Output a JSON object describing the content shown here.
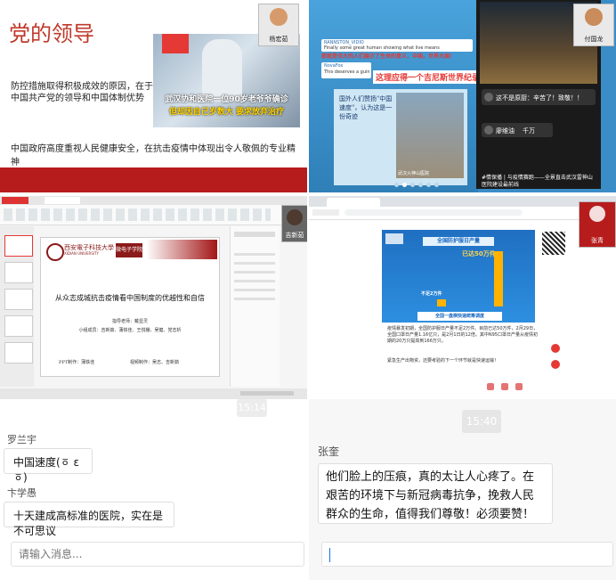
{
  "q1": {
    "title": "党的领导",
    "line1": "防控措施取得积极成效的原因，在于",
    "line2": "中国共产党的领导和中国体制优势",
    "line3": "中国政府高度重视人民健康安全，在抗击疫情中体现出令人敬佩的专业精神",
    "caption1": "武汉协和医院一位90岁老爷爷确诊",
    "caption2": "但却因自己岁数大 要求放弃治疗",
    "participant": "杨宏茹"
  },
  "q2": {
    "banner": "这理应得一个吉尼斯世界纪录",
    "comment_name": "RANNSTON_VIDIO",
    "comment_text": "Finally some great human showing what live means",
    "comment_cn": "那就是伟大的人们展示了生命的意义，中国，世界大国！",
    "reply_name": "NovaFox",
    "reply_text": "This deserves a guinness record",
    "book_text": "国外人们赞扬\"中国速度\"，认为这是一份奇迹",
    "inset_caption": "武汉火神山医院",
    "chat_msg1": "这不是原厨：辛苦了！致敬！！",
    "chat_msg2": "千万",
    "chat_name2": "廖维油",
    "footer": "#情保播 | 与疫情赛跑——全景直击武汉雷神山医院建设最前线",
    "participant": "付国龙"
  },
  "q3": {
    "school_cn": "西安電子科技大學",
    "school_en": "XIDIAN UNIVERSITY",
    "logo_text": "微电子学院",
    "slide_title": "从众志成城抗击疫情看中国制度的优越性和自信",
    "teacher": "指导老师：戴显灵",
    "members": "小组成员：吉新茹、蒲铁佳、王悦棚、吴健、党志析",
    "ppt": "PPT制作：蒲铁佳",
    "video": "视频制作：吴志、吉新茹",
    "participant": "吉新茹"
  },
  "q4": {
    "img_title": "全国防护服日产量",
    "img_big": "已达50万件",
    "img_small": "不足2万件",
    "img_footer": "全国一盘棋快速统筹调度",
    "para1": "疫情暴发初期，全国防护服日产量不足2万件。目前已达50万件，2月29日，全国口罩日产量1.16亿只，是2月1日的12倍。其中N95口罩日产量从疫情初期的20万只提高到166万只。",
    "para2": "紧急生产出物资，还要考验的下一个环节就是快速运输！",
    "participant": "张青"
  },
  "chat": {
    "left_time": "15:14",
    "left_msgs": [
      {
        "sender": "罗兰宇",
        "text": "中国速度(ㆆ ε ㆆ)"
      },
      {
        "sender": "卞学愚",
        "text": "十天建成高标准的医院，实在是不可思议"
      }
    ],
    "left_placeholder": "请输入消息...",
    "right_time": "15:40",
    "right_sender": "张奎",
    "right_text": "他们脸上的压痕，真的太让人心疼了。在艰苦的环境下与新冠病毒抗争，挽救人民群众的生命，值得我们尊敬！必须要赞！"
  }
}
